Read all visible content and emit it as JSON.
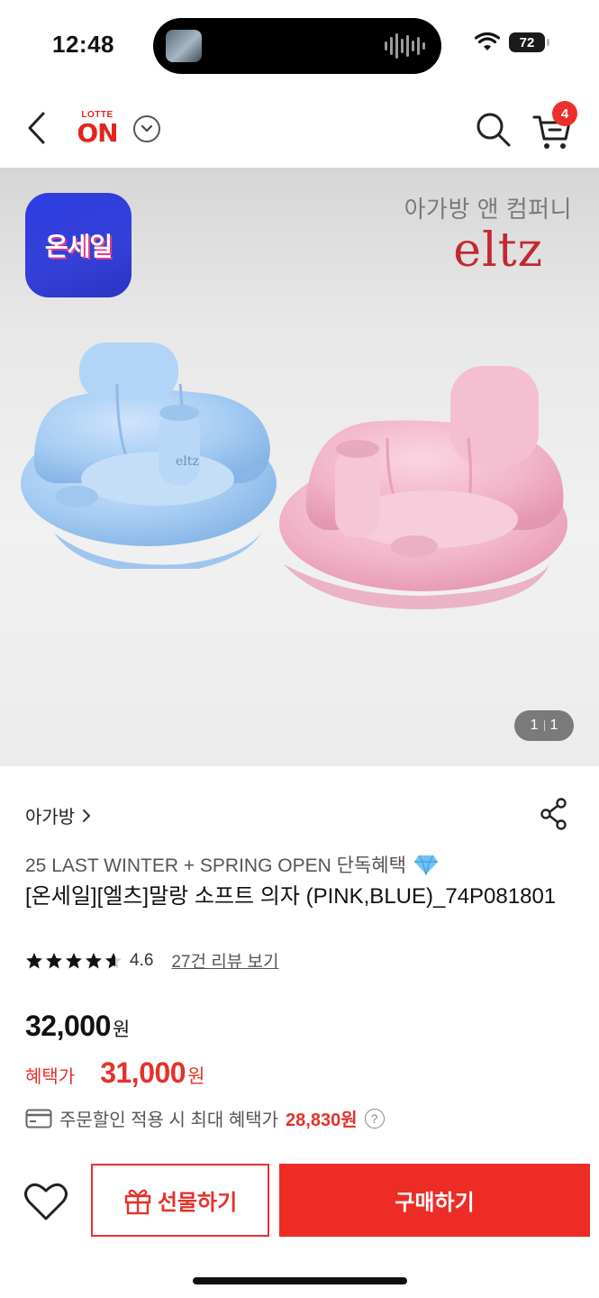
{
  "status_bar": {
    "time": "12:48",
    "battery": "72"
  },
  "header": {
    "logo_top": "LOTTE",
    "logo_main": "ON",
    "cart_count": "4"
  },
  "product_image": {
    "badge_text": "온세일",
    "brand_sub": "아가방 앤 컴퍼니",
    "brand_logo": "eltz",
    "counter_current": "1",
    "counter_total": "1"
  },
  "product": {
    "category": "아가방",
    "promo": "25 LAST WINTER + SPRING OPEN 단독혜택",
    "title": "[온세일][엘츠]말랑 소프트 의자 (PINK,BLUE)_74P081801",
    "rating": "4.6",
    "rating_fraction": 0.92,
    "review_link": "27건 리뷰 보기",
    "price": "32,000",
    "price_unit": "원",
    "benefit_label": "혜택가",
    "benefit_price": "31,000",
    "benefit_unit": "원",
    "card_text": "주문할인 적용 시 최대 혜택가",
    "card_amount": "28,830원"
  },
  "actions": {
    "gift_label": "선물하기",
    "buy_label": "구매하기"
  },
  "colors": {
    "accent": "#ec2c25",
    "badge_blue": "#2d3de0",
    "brand_red": "#c4282f"
  }
}
